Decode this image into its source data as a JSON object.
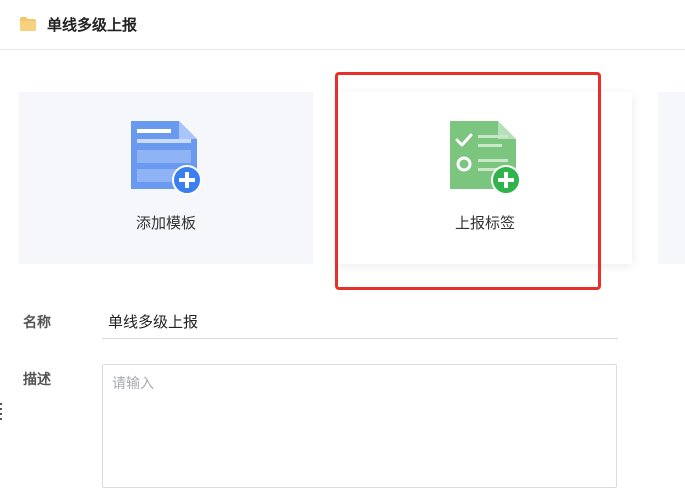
{
  "header": {
    "title": "单线多级上报",
    "icon": "folder-icon"
  },
  "cards": [
    {
      "label": "添加模板",
      "icon": "add-template-icon"
    },
    {
      "label": "上报标签",
      "icon": "report-tag-icon",
      "highlighted": true
    }
  ],
  "form": {
    "name_label": "名称",
    "name_value": "单线多级上报",
    "desc_label": "描述",
    "desc_placeholder": "请输入"
  },
  "colors": {
    "highlight": "#e8302a",
    "template_icon": "#6a9af0",
    "report_icon": "#7cc57e",
    "plus_blue": "#3b7ef0",
    "plus_green": "#2fb34a",
    "folder": "#f5c56b"
  }
}
